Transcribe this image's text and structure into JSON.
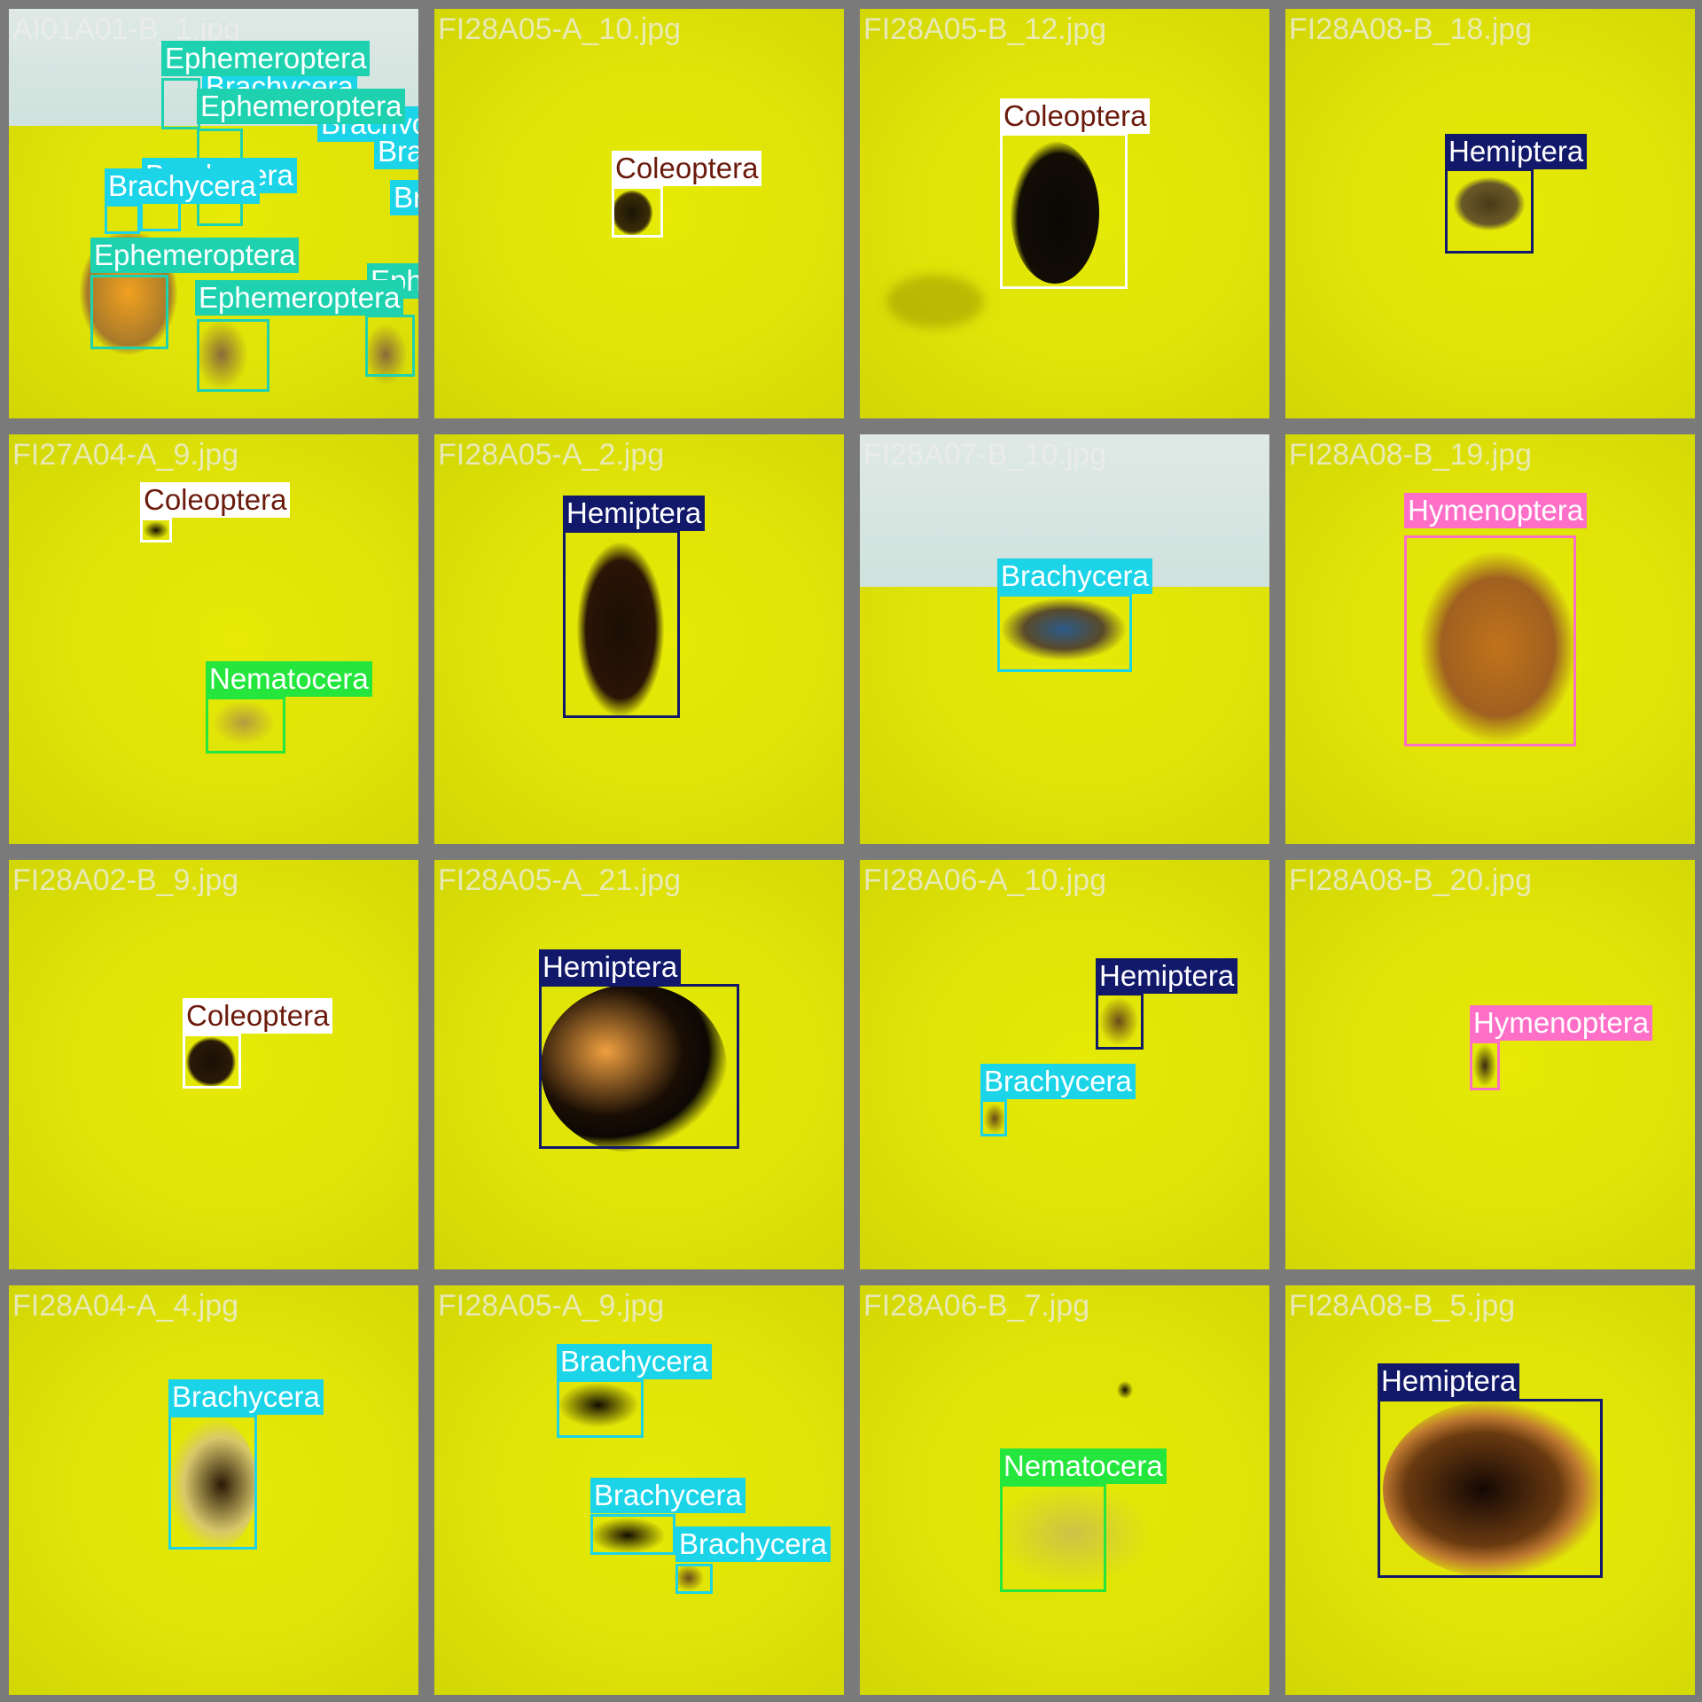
{
  "colors": {
    "Ephemeroptera": "#1ed2b0",
    "Brachycera": "#1bd4e8",
    "Coleoptera": "#ffffff",
    "Hemiptera": "#12196b",
    "Nematocera": "#24e63c",
    "Hymenoptera": "#ff6fc7"
  },
  "tile_filenames": [
    "AI01A01-B_1.jpg",
    "FI28A05-A_10.jpg",
    "FI28A05-B_12.jpg",
    "FI28A08-B_18.jpg",
    "FI27A04-A_9.jpg",
    "FI28A05-A_2.jpg",
    "FI28A07-B_10.jpg",
    "FI28A08-B_19.jpg",
    "FI28A02-B_9.jpg",
    "FI28A05-A_21.jpg",
    "FI28A06-A_10.jpg",
    "FI28A08-B_20.jpg",
    "FI28A04-A_4.jpg",
    "FI28A05-A_9.jpg",
    "FI28A06-B_7.jpg",
    "FI28A08-B_5.jpg"
  ],
  "labels": {
    "ephemeroptera": "Ephemeroptera",
    "brachycera": "Brachycera",
    "coleoptera": "Coleoptera",
    "hemiptera": "Hemiptera",
    "nematocera": "Nematocera",
    "hymenoptera": "Hymenoptera"
  }
}
